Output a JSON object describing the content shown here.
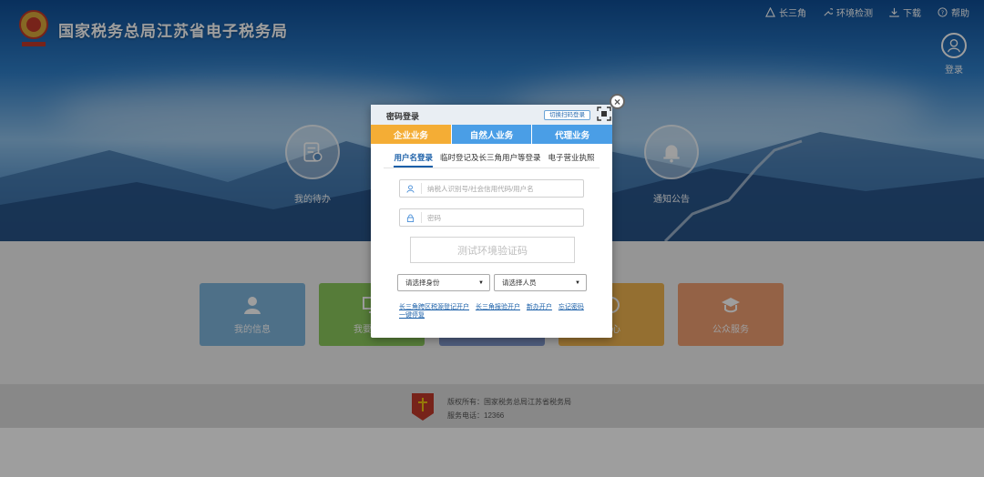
{
  "header": {
    "site_title": "国家税务总局江苏省电子税务局",
    "nav": [
      {
        "label": "长三角",
        "icon": "triangle-icon"
      },
      {
        "label": "环境检测",
        "icon": "wrench-icon"
      },
      {
        "label": "下载",
        "icon": "download-icon"
      },
      {
        "label": "帮助",
        "icon": "help-icon"
      }
    ],
    "login_label": "登录"
  },
  "banner": {
    "left_item": "我的待办",
    "right_item": "通知公告"
  },
  "tiles": [
    {
      "label": "我的信息",
      "color": "#7fb5dc"
    },
    {
      "label": "我要办税",
      "color": "#8cc95d"
    },
    {
      "label": "",
      "color": "#7f95c8"
    },
    {
      "label": "中心",
      "color": "#efb44f"
    },
    {
      "label": "公众服务",
      "color": "#ef9e71"
    }
  ],
  "footer": {
    "copyright": "版权所有：国家税务总局江苏省税务局",
    "phone": "服务电话：12366"
  },
  "dialog": {
    "title": "密码登录",
    "qr_switch": "切换扫码登录",
    "close": "×",
    "biz_tabs": [
      "企业业务",
      "自然人业务",
      "代理业务"
    ],
    "login_tabs": [
      "用户名登录",
      "临时登记及长三角用户等登录",
      "电子营业执照"
    ],
    "username_placeholder": "纳税人识别号/社会信用代码/用户名",
    "password_placeholder": "密码",
    "captcha": "测试环境验证码",
    "identity_select": "请选择身份",
    "person_select": "请选择人员",
    "links": [
      "长三角跨区税源登记开户",
      "长三角报验开户",
      "新办开户",
      "忘记密码",
      "一键停复"
    ]
  },
  "colors": {
    "biz_active": "#f4ad35",
    "biz_inactive": "#4a9ee6",
    "link": "#1a5fa8"
  }
}
